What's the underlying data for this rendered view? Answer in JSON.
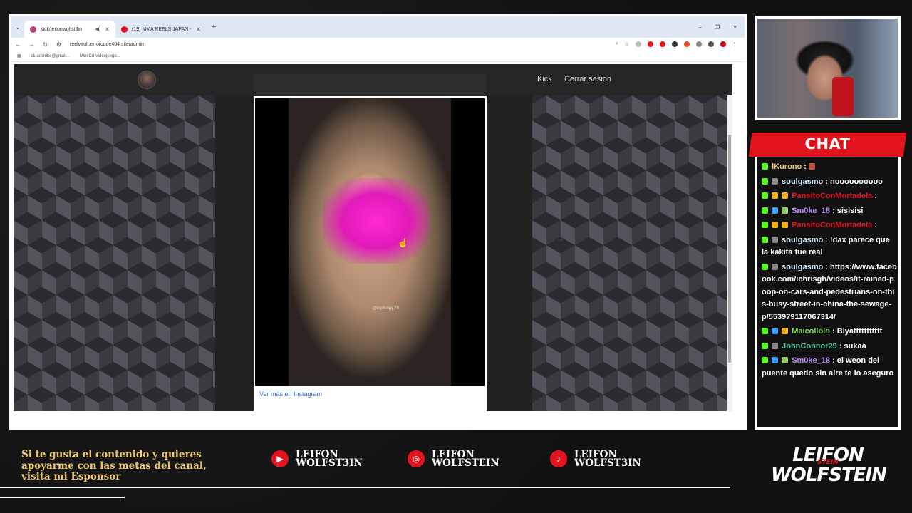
{
  "browser": {
    "tabs": [
      {
        "title": "kick/leifonwolfst3in",
        "favicon_color": "#b43c6e",
        "active": true
      },
      {
        "title": "(19) MMA REELS JAPAN - YouTu",
        "favicon_color": "#e2141e",
        "active": false
      }
    ],
    "url": "reelvault.errorcode404.site/admin",
    "bookmarks": [
      "claudstrike@gmail...",
      "Mini Cd Videojuego..."
    ]
  },
  "site": {
    "nav": {
      "kick_label": "Kick",
      "logout_label": "Cerrar sesion"
    },
    "embed": {
      "watermark": "@topfunny.79",
      "instagram_link": "Ver más en Instagram"
    },
    "prev_arrow": "←",
    "next_arrow": "→"
  },
  "chat": {
    "title": "CHAT",
    "messages": [
      {
        "user": "lKurono",
        "user_color": "#f0c76a",
        "text": ":"
      },
      {
        "user": "soulgasmo",
        "user_color": "#cfe8f7",
        "text": ": noooooooooo"
      },
      {
        "user": "PansitoConMortadela",
        "user_color": "#e2141e",
        "text": ":"
      },
      {
        "user": "Sm0ke_18",
        "user_color": "#b58cf5",
        "text": ": sisisisi"
      },
      {
        "user": "PansitoConMortadela",
        "user_color": "#e2141e",
        "text": ":"
      },
      {
        "user": "soulgasmo",
        "user_color": "#cfe8f7",
        "text": ": !dax parece que la kakita fue real"
      },
      {
        "user": "soulgasmo",
        "user_color": "#cfe8f7",
        "text": ": https://www.facebook.com/ichrisgh/videos/it-rained-poop-on-cars-and-pedestrians-on-this-busy-street-in-china-the-sewage-p/553979117067314/"
      },
      {
        "user": "Maicollolo",
        "user_color": "#7fd957",
        "text": ": Blyattttttttttt"
      },
      {
        "user": "JohnConnor29",
        "user_color": "#4fc3a1",
        "text": ": sukaa"
      },
      {
        "user": "Sm0ke_18",
        "user_color": "#b58cf5",
        "text": ": el weon del puente quedo sin aire te lo aseguro"
      }
    ]
  },
  "footer": {
    "sponsor": "Si te gusta el contenido y quieres apoyarme con las metas del canal, visita mi Esponsor",
    "youtube": "LEIFON WOLFST3IN",
    "instagram": "LEIFON WOLFSTEIN",
    "tiktok": "LEIFON WOLFST3IN",
    "brand_line1": "LEIFON",
    "brand_line2": "WOLFSTEIN",
    "brand_strike": "STEIN"
  }
}
